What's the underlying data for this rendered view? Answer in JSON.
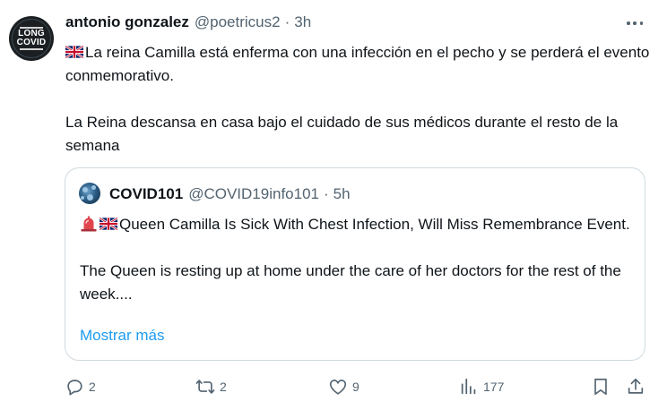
{
  "tweet": {
    "author_name": "antonio gonzalez",
    "author_handle": "@poetricus2",
    "separator": "·",
    "time": "3h",
    "avatar_text_1": "LONG",
    "avatar_text_2": "COVID",
    "line1": "La reina Camilla está enferma con una infección en el pecho y se perderá el evento conmemorativo.",
    "line2": "La Reina descansa en casa bajo el cuidado de sus médicos durante el resto de la semana"
  },
  "quote": {
    "author_name": "COVID101",
    "author_handle": "@COVID19info101",
    "separator": "·",
    "time": "5h",
    "line1": "Queen Camilla Is Sick With Chest Infection, Will Miss Remembrance Event.",
    "line2": "The Queen is resting up at home under the care of her doctors for the rest of the week....",
    "show_more": "Mostrar más"
  },
  "actions": {
    "replies": "2",
    "reposts": "2",
    "likes": "9",
    "views": "177"
  },
  "icons": {
    "flag": "uk-flag-icon",
    "siren": "siren-icon",
    "reply": "reply-icon",
    "repost": "repost-icon",
    "like": "heart-icon",
    "views": "views-icon",
    "bookmark": "bookmark-icon",
    "share": "share-icon",
    "more": "more-icon"
  },
  "colors": {
    "text": "#0f1419",
    "secondary": "#536471",
    "link": "#1d9bf0",
    "border": "#cfd9de"
  }
}
